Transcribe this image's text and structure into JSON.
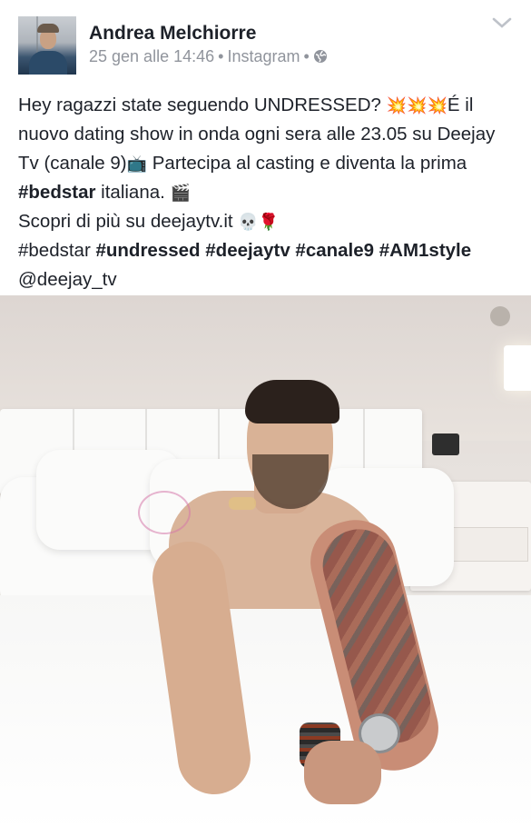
{
  "post": {
    "author": "Andrea Melchiorre",
    "timestamp": "25 gen alle 14:46",
    "source": "Instagram",
    "privacy_icon": "globe-icon",
    "menu_icon": "chevron-down-icon",
    "text": {
      "line1": "Hey ragazzi state seguendo UNDRESSED? ",
      "emoji_burst": "💥💥💥",
      "line1b": "É il nuovo dating show in onda ogni sera alle 23.05 su Deejay Tv (canale 9)",
      "emoji_tv": "📺",
      "line2a": " Partecipa al casting e diventa la prima ",
      "tag_bedstar": "#bedstar",
      "line2b": " italiana. ",
      "emoji_clapper": "🎬",
      "line3": "Scopri di più su deejaytv.it ",
      "emoji_skull_rose": "💀🌹",
      "hashtag_plain": "#bedstar",
      "hashtags": [
        "#undressed",
        "#deejaytv",
        "#canale9",
        "#AM1style"
      ],
      "mention": "@deejay_tv"
    }
  },
  "colors": {
    "name": "#1d2129",
    "meta": "#90949c",
    "text": "#1d2129"
  }
}
